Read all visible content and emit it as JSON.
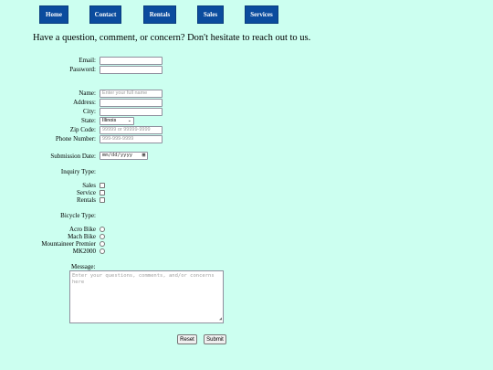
{
  "nav": {
    "home": "Home",
    "contact": "Contact",
    "rentals": "Rentals",
    "sales": "Sales",
    "services": "Services"
  },
  "intro": "Have a question, comment, or concern? Don't hesitate to reach out to us.",
  "form": {
    "email_label": "Email:",
    "password_label": "Password:",
    "name_label": "Name:",
    "name_placeholder": "Enter your full name",
    "address_label": "Address:",
    "city_label": "City:",
    "state_label": "State:",
    "state_value": "Illinois",
    "zip_label": "Zip Code:",
    "zip_placeholder": "99999 or 99999-9999",
    "phone_label": "Phone Number:",
    "phone_placeholder": "999-999-9999",
    "date_label": "Submission Date:",
    "date_placeholder": "mm/dd/yyyy",
    "inquiry_label": "Inquiry Type:",
    "inquiry_options": [
      "Sales",
      "Service",
      "Rentals"
    ],
    "bicycle_label": "Bicycle Type:",
    "bicycle_options": [
      "Acro Bike",
      "Mach Bike",
      "Mountaineer Premier",
      "MK2000"
    ],
    "message_label": "Message:",
    "message_placeholder": "Enter your questions, comments, and/or concerns here",
    "reset_label": "Reset",
    "submit_label": "Submit"
  },
  "colors": {
    "background": "#ccfff0",
    "nav_bg": "#0b4c9e"
  }
}
